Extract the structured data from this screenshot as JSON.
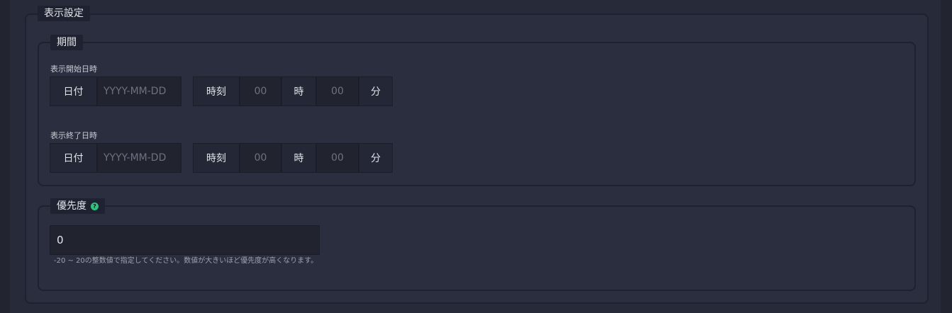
{
  "display_settings": {
    "legend": "表示設定",
    "period": {
      "legend": "期間",
      "start": {
        "label": "表示開始日時",
        "date_label": "日付",
        "date_placeholder": "YYYY-MM-DD",
        "time_label": "時刻",
        "hour_placeholder": "00",
        "hour_unit": "時",
        "minute_placeholder": "00",
        "minute_unit": "分"
      },
      "end": {
        "label": "表示終了日時",
        "date_label": "日付",
        "date_placeholder": "YYYY-MM-DD",
        "time_label": "時刻",
        "hour_placeholder": "00",
        "hour_unit": "時",
        "minute_placeholder": "00",
        "minute_unit": "分"
      }
    },
    "priority": {
      "legend": "優先度",
      "help_icon": "question-circle-icon",
      "value": "0",
      "hint": "-20 ~ 20の整数値で指定してください。数値が大きいほど優先度が高くなります。"
    }
  },
  "colors": {
    "background": "#262a39",
    "panel": "#2a2e3e",
    "input": "#21242f",
    "help_icon": "#2ec27e"
  }
}
